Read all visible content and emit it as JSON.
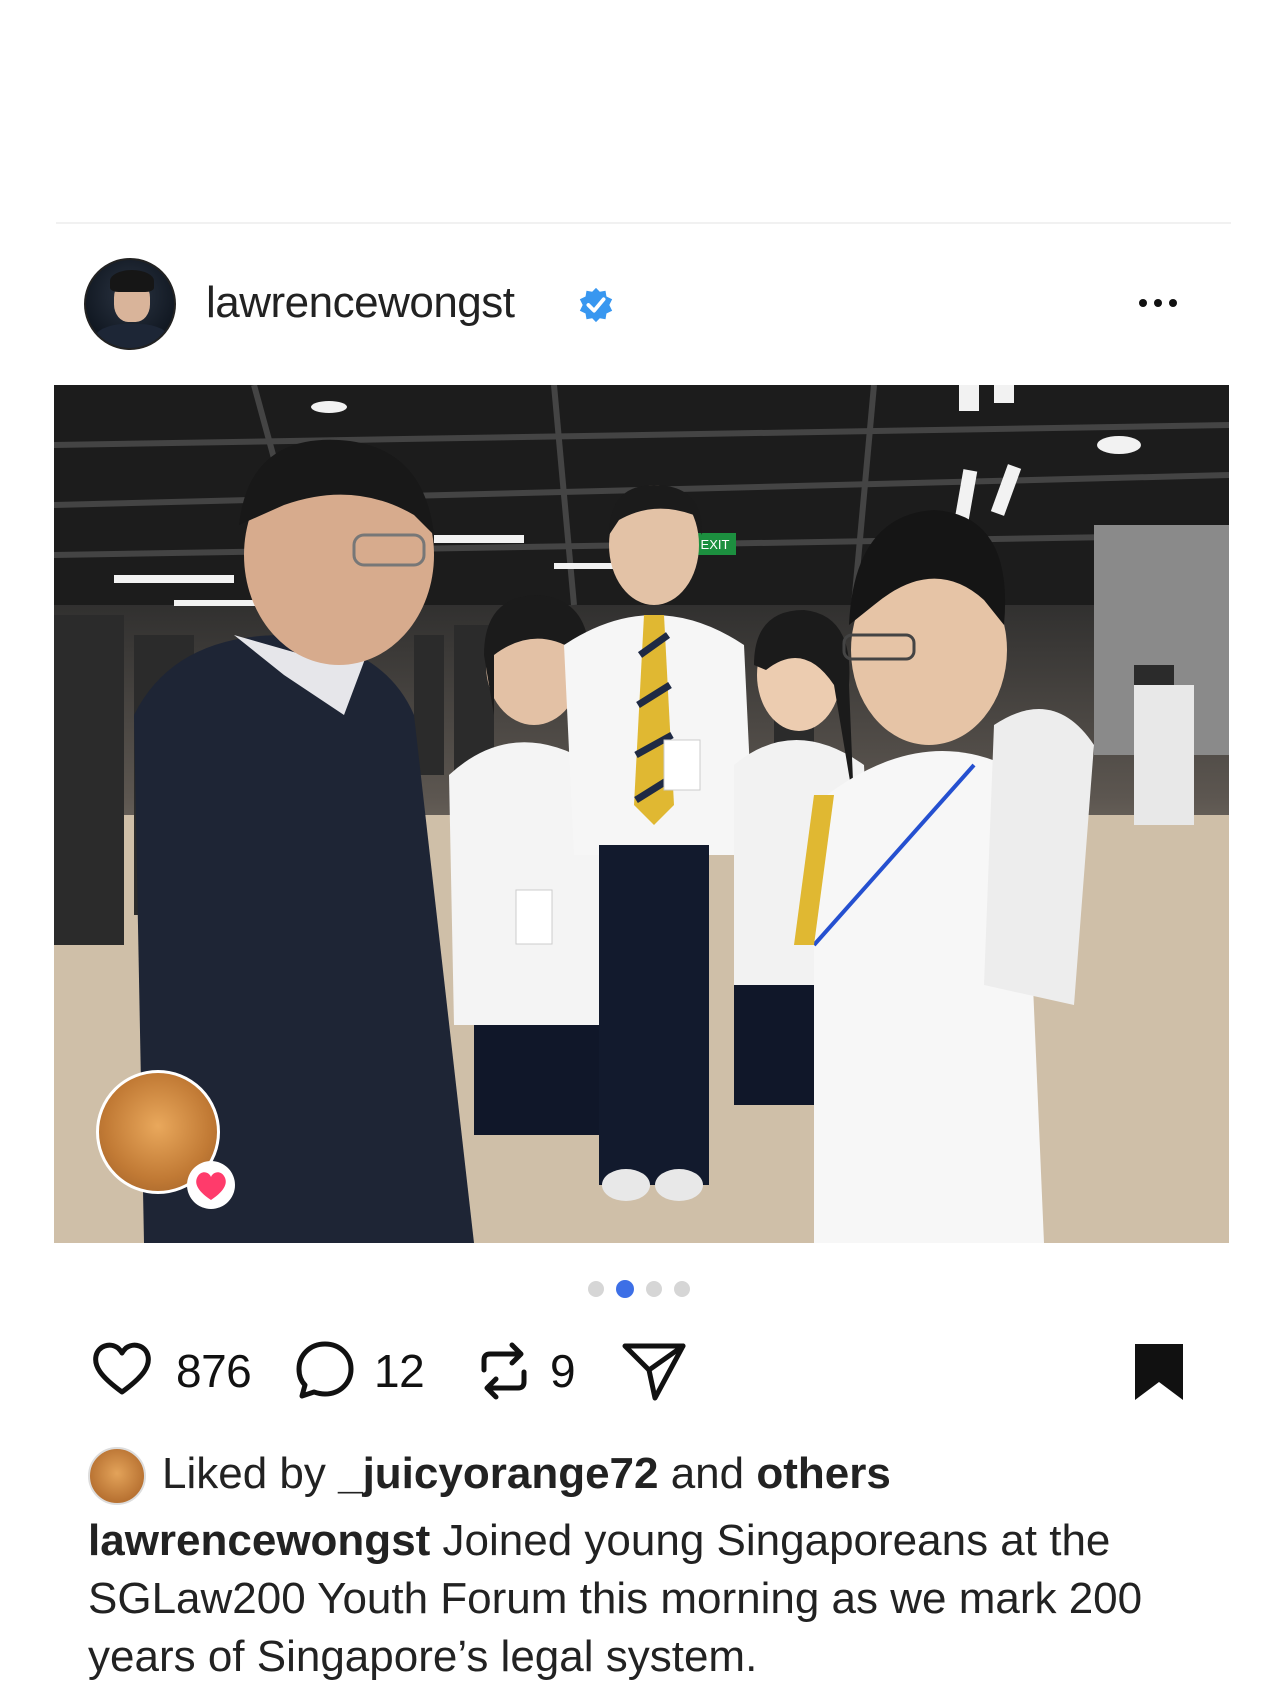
{
  "post": {
    "username": "lawrencewongst",
    "verified": true,
    "avatar_icon": "profile-photo",
    "more_icon": "ellipsis-icon"
  },
  "photo": {
    "exit_sign": "EXIT",
    "carousel": {
      "total": 4,
      "active_index": 1
    }
  },
  "actions": {
    "likes": "876",
    "comments": "12",
    "reposts": "9",
    "icons": [
      "heart-icon",
      "comment-icon",
      "repost-icon",
      "send-icon",
      "bookmark-icon"
    ]
  },
  "liked_by": {
    "prefix": "Liked by ",
    "user": "_juicyorange72",
    "middle": " and ",
    "others": "others"
  },
  "caption": {
    "username": "lawrencewongst",
    "text": " Joined young Singaporeans at the SGLaw200 Youth Forum this morning as we mark 200 years of Singapore’s legal system."
  },
  "colors": {
    "verified_blue": "#3897f0",
    "active_dot": "#3d6fe6",
    "heart_pink": "#ff3b6b"
  }
}
